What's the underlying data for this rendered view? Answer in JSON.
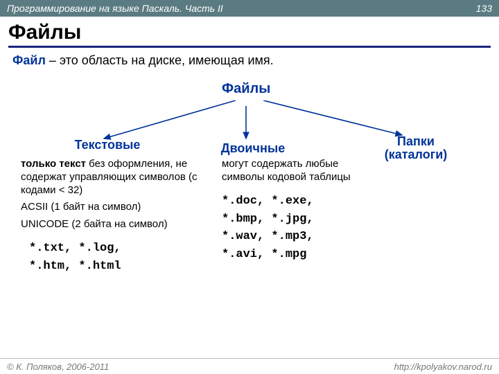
{
  "header": {
    "course": "Программирование на языке Паскаль. Часть II",
    "page": "133"
  },
  "title": "Файлы",
  "definition": {
    "term": "Файл",
    "rest": " – это область на диске, имеющая имя."
  },
  "root": "Файлы",
  "branches": {
    "text": "Текстовые",
    "binary": "Двоичные",
    "folders_line1": "Папки",
    "folders_line2": "(каталоги)"
  },
  "text_col": {
    "p1_bold": "только текст",
    "p1_rest": " без оформления, не содержат управляющих символов (с кодами < 32)",
    "p2": "ACSII (1 байт на символ)",
    "p3": "UNICODE (2 байта на символ)",
    "ext1": "*.txt, *.log,",
    "ext2": "*.htm, *.html"
  },
  "bin_col": {
    "p1": "могут содержать любые символы кодовой таблицы",
    "ext1": "*.doc, *.exe,",
    "ext2": "*.bmp, *.jpg,",
    "ext3": "*.wav, *.mp3,",
    "ext4": "*.avi, *.mpg"
  },
  "footer": {
    "copyright": "© К. Поляков, 2006-2011",
    "url": "http://kpolyakov.narod.ru"
  }
}
